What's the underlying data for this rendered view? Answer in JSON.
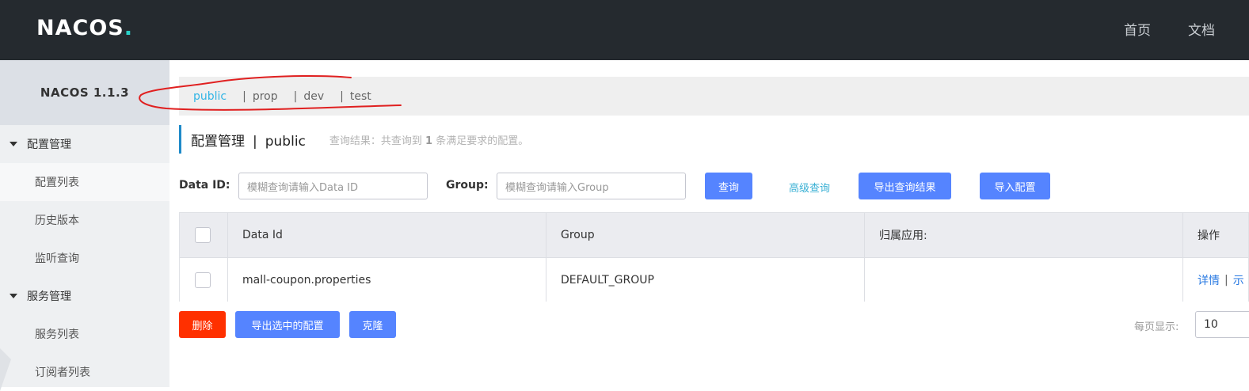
{
  "header": {
    "logo": {
      "part1": "NA",
      "part2": "C",
      "part3": "OS",
      "dot": "."
    },
    "nav": [
      "首页",
      "文档"
    ]
  },
  "sidebar": {
    "version": "NACOS 1.1.3",
    "groups": [
      {
        "label": "配置管理",
        "items": [
          "配置列表",
          "历史版本",
          "监听查询"
        ]
      },
      {
        "label": "服务管理",
        "items": [
          "服务列表",
          "订阅者列表"
        ]
      }
    ]
  },
  "namespaces": {
    "items": [
      "public",
      "prop",
      "dev",
      "test"
    ],
    "active": "public",
    "separator": "|"
  },
  "page": {
    "title": "配置管理",
    "title_sep": "|",
    "namespace": "public",
    "result_prefix": "查询结果：共查询到",
    "result_count": "1",
    "result_suffix": "条满足要求的配置。"
  },
  "search": {
    "dataid_label": "Data ID:",
    "dataid_placeholder": "模糊查询请输入Data ID",
    "group_label": "Group:",
    "group_placeholder": "模糊查询请输入Group",
    "query_button": "查询",
    "advanced_link": "高级查询",
    "export_button": "导出查询结果",
    "import_button": "导入配置"
  },
  "table": {
    "columns": [
      "Data Id",
      "Group",
      "归属应用:",
      "操作"
    ],
    "rows": [
      {
        "data_id": "mall-coupon.properties",
        "group": "DEFAULT_GROUP",
        "app": "",
        "op_detail": "详情",
        "op_sep": "|",
        "op_more": "示"
      }
    ]
  },
  "actions": {
    "delete_button": "删除",
    "export_selected_button": "导出选中的配置",
    "clone_button": "克隆",
    "page_size_label": "每页显示:",
    "page_size_value": "10"
  },
  "colors": {
    "topbar": "#252a2f",
    "primary": "#5584ff",
    "danger": "#ff3000",
    "active_namespace": "#33b5e5",
    "annotation": "#e02020"
  }
}
